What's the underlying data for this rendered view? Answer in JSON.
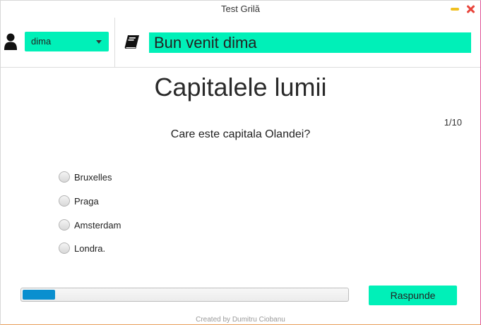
{
  "window": {
    "title": "Test Grilă"
  },
  "header": {
    "user_selected": "dima",
    "welcome_text": "Bun venit dima",
    "user_icon": "user-icon",
    "book_icon": "book-icon"
  },
  "quiz": {
    "title": "Capitalele lumii",
    "counter": "1/10",
    "question": "Care este capitala Olandei?",
    "options": [
      "Bruxelles",
      "Praga",
      "Amsterdam",
      "Londra."
    ],
    "progress": 0.1,
    "answer_button": "Raspunde"
  },
  "footer": {
    "credit": "Created by Dumitru Ciobanu"
  },
  "colors": {
    "accent": "#00f0b8",
    "progress": "#0a8fcf",
    "close": "#e8453c",
    "minimize": "#f0c020"
  }
}
